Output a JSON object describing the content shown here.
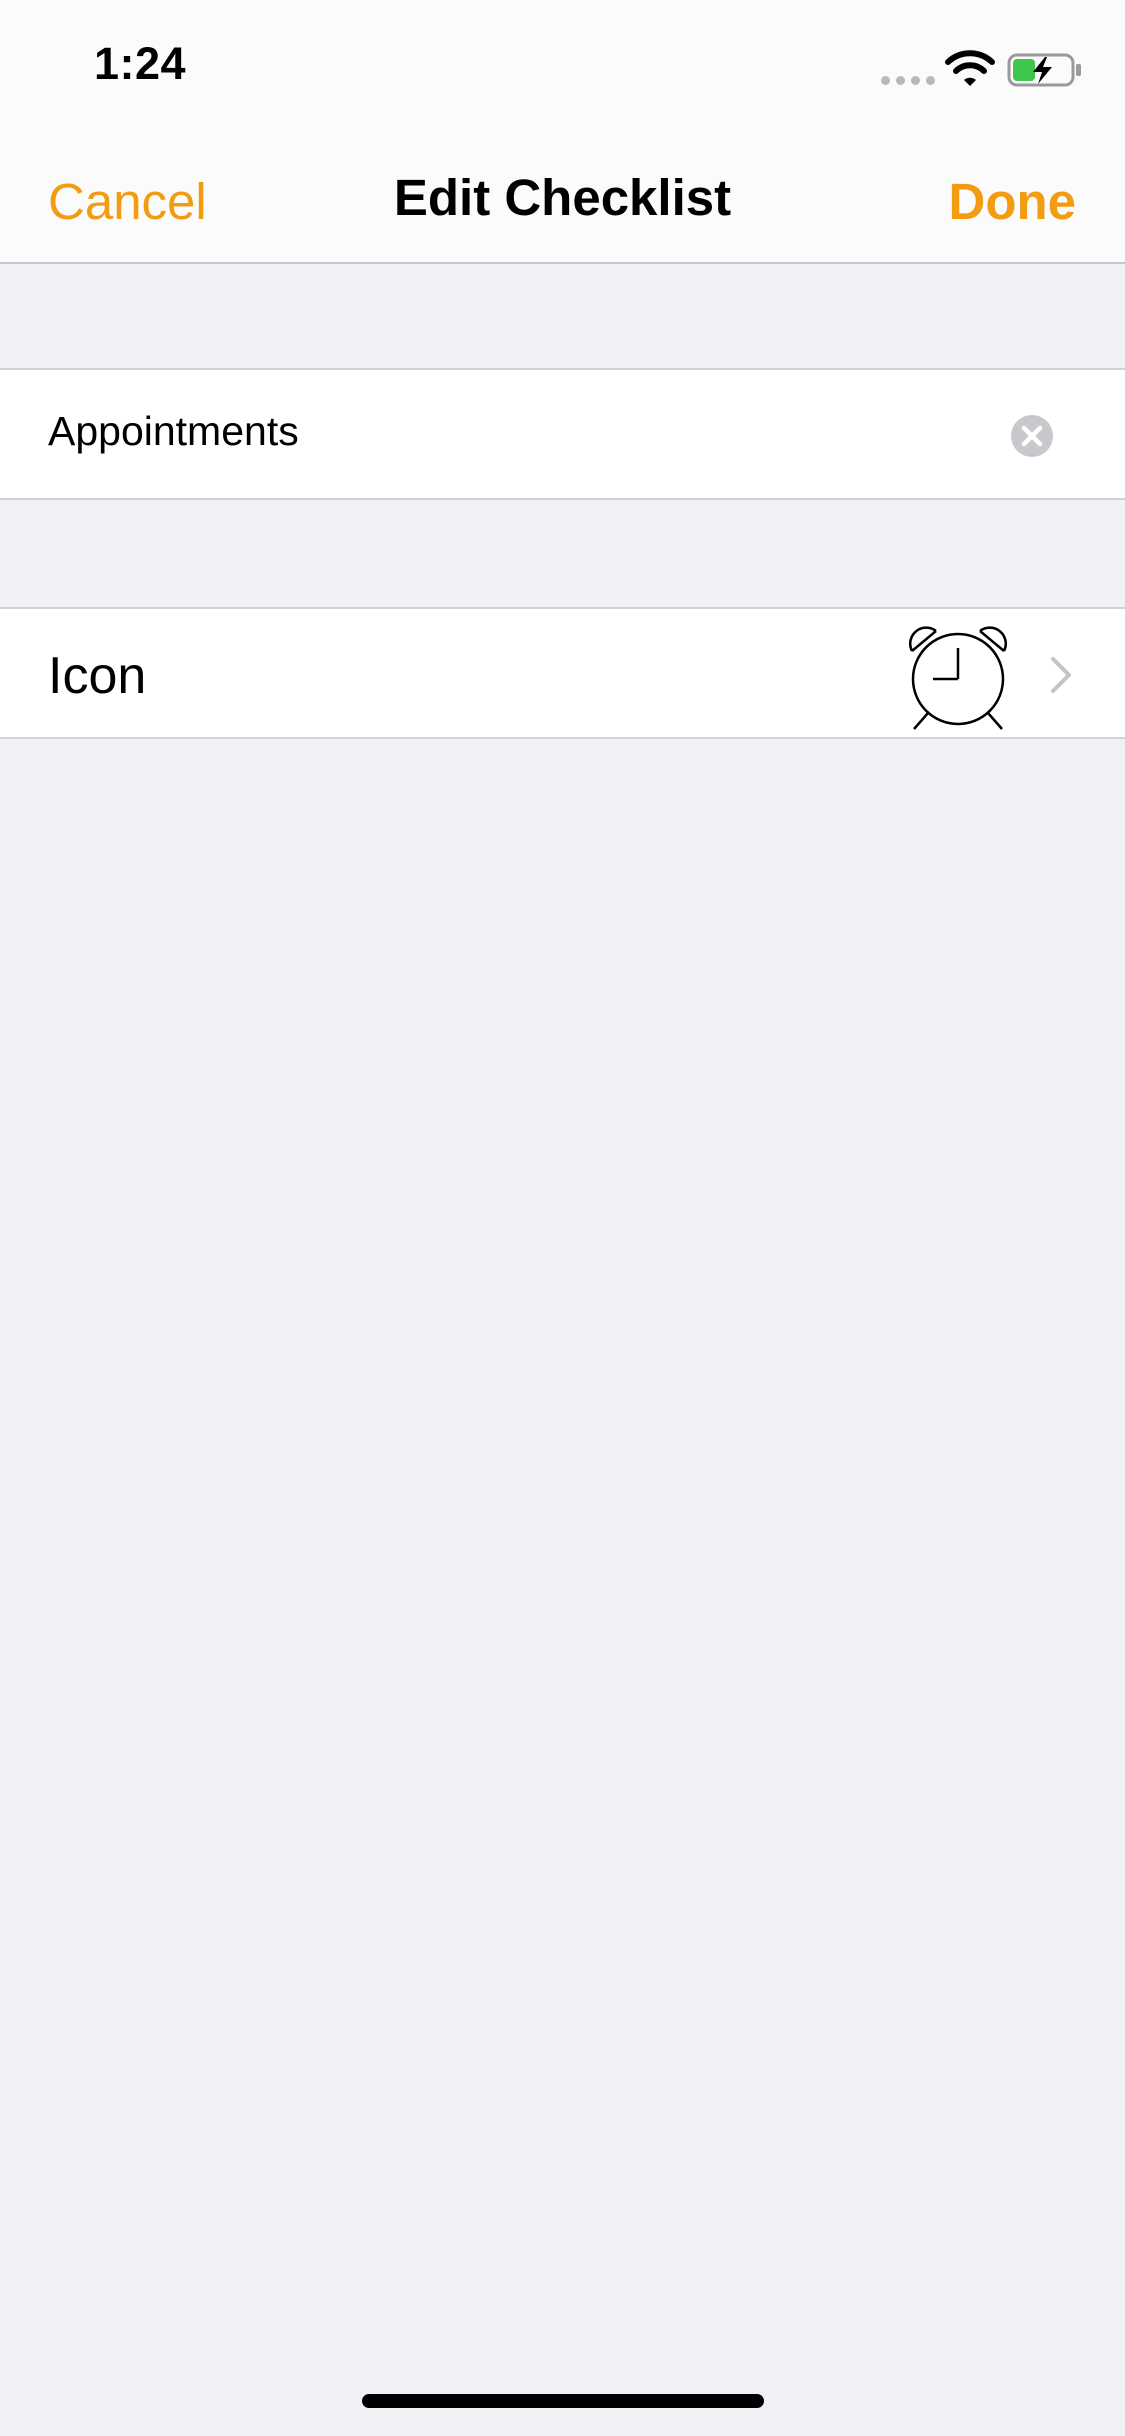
{
  "status_bar": {
    "time": "1:24"
  },
  "nav": {
    "cancel_label": "Cancel",
    "title": "Edit Checklist",
    "done_label": "Done"
  },
  "form": {
    "name_value": "Appointments",
    "icon_label": "Icon",
    "icon_name": "alarm-clock-icon"
  },
  "colors": {
    "accent": "#f39c12",
    "background": "#f0f0f5",
    "battery_fill": "#3ec74d"
  }
}
